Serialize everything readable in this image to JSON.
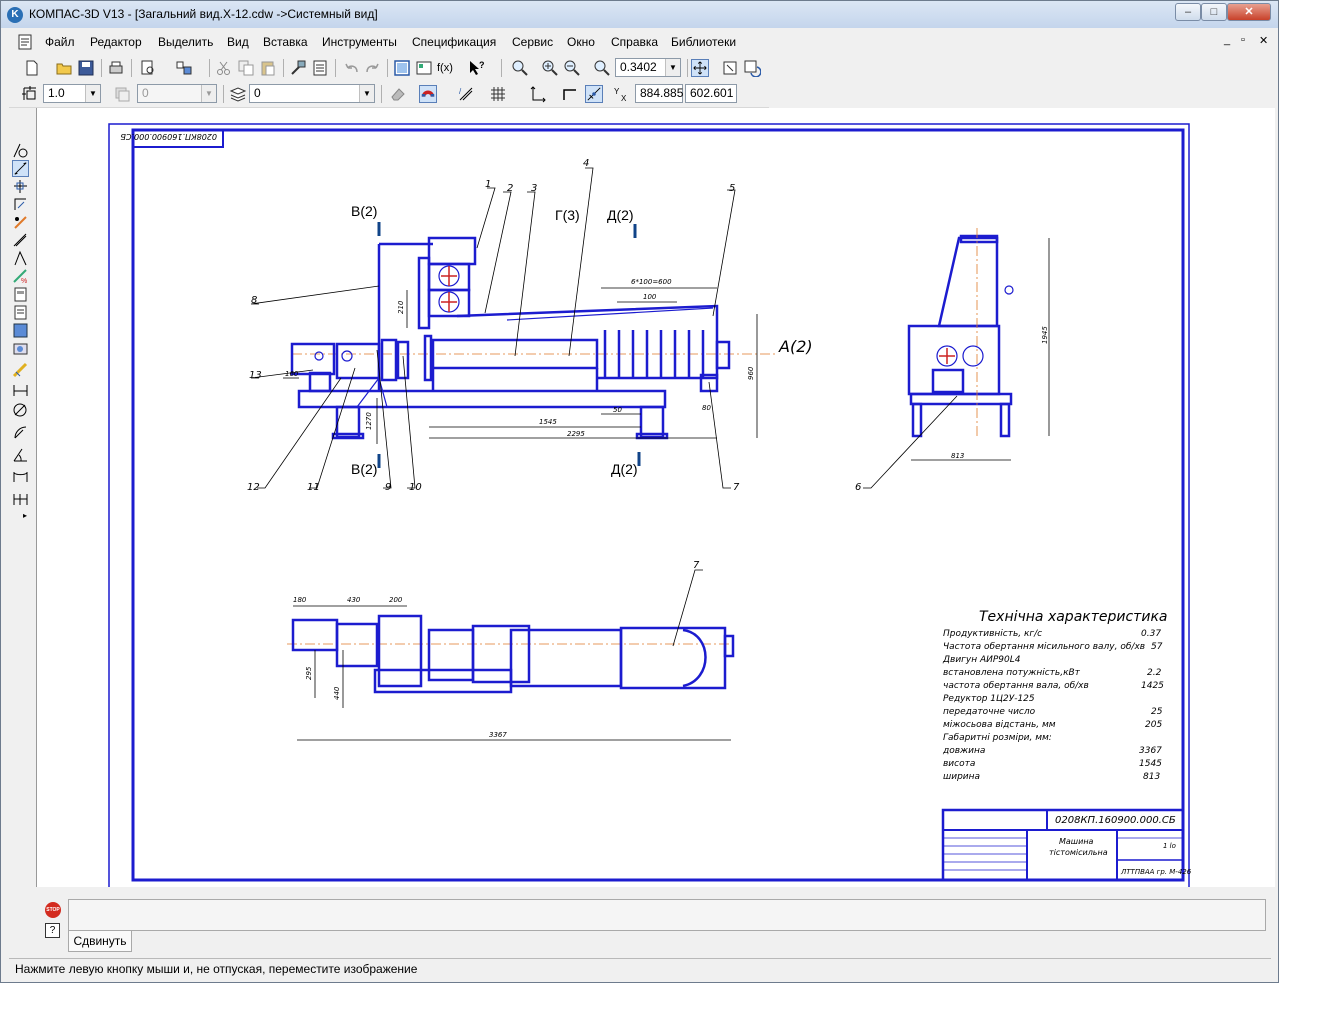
{
  "window": {
    "title": "КОМПАС-3D V13 - [Загальний вид.Х-12.cdw ->Системный вид]",
    "app_icon": "kompas-logo-icon",
    "controls": {
      "minimize": "–",
      "maximize": "□",
      "close": "✕"
    }
  },
  "menu": {
    "items": [
      "Файл",
      "Редактор",
      "Выделить",
      "Вид",
      "Вставка",
      "Инструменты",
      "Спецификация",
      "Сервис",
      "Окно",
      "Справка",
      "Библиотеки"
    ],
    "doc_controls": {
      "minimize": "_",
      "restore": "▫",
      "close": "✕"
    }
  },
  "toolbar1": {
    "zoom_value": "0.3402",
    "fx_label": "f(x)"
  },
  "toolbar2": {
    "line_scale": "1.0",
    "layer_disabled": "0",
    "style_value": "0",
    "coord_x": "884.885",
    "coord_y": "602.601"
  },
  "drawing": {
    "stamp_corner": "0208КП.160900.000.СБ",
    "view_labels": {
      "b_top": "В(2)",
      "b_bottom": "В(2)",
      "g": "Г(3)",
      "d_top": "Д(2)",
      "d_bottom": "Д(2)",
      "a": "А(2)"
    },
    "callouts": [
      "1",
      "2",
      "3",
      "4",
      "5",
      "6",
      "7",
      "8",
      "9",
      "10",
      "11",
      "12",
      "13",
      "7"
    ],
    "dimensions": {
      "d160": "160",
      "d210": "210",
      "d1270": "1270",
      "d1545": "1545",
      "d2295": "2295",
      "d50": "50",
      "d100": "100",
      "d6x100": "6*100=600",
      "d960": "960",
      "d1945": "1945",
      "d813": "813",
      "d180": "180",
      "d430": "430",
      "d200": "200",
      "d3367": "3367",
      "d295": "295",
      "d440": "440",
      "d80": "80"
    },
    "tech": {
      "title": "Технічна характеристика",
      "rows": [
        {
          "label": "Продуктивність, кг/с",
          "value": "0.37"
        },
        {
          "label": "Частота обертання місильного валу, об/хв",
          "value": "57"
        },
        {
          "label": "Двигун  АИР90L4",
          "value": ""
        },
        {
          "label": "  встановлена потужність,кВт",
          "value": "2.2"
        },
        {
          "label": "  частота обертання вала, об/хв",
          "value": "1425"
        },
        {
          "label": "Редуктор  1Ц2У-125",
          "value": ""
        },
        {
          "label": "  передаточне число",
          "value": "25"
        },
        {
          "label": "  міжосьова відстань, мм",
          "value": "205"
        },
        {
          "label": "Габаритні розміри, мм:",
          "value": ""
        },
        {
          "label": "    довжина",
          "value": "3367"
        },
        {
          "label": "    висота",
          "value": "1545"
        },
        {
          "label": "    ширина",
          "value": "813"
        }
      ]
    },
    "titleblock": {
      "code": "0208КП.160900.000.СБ",
      "name_line1": "Машина",
      "name_line2": "тістомісильна",
      "sheet": "1 lo",
      "org": "ЛТТПВАА гр. М-426"
    }
  },
  "command": {
    "stop_label": "STOP",
    "help_label": "?",
    "tab_label": "Сдвинуть"
  },
  "status": {
    "message": "Нажмите левую кнопку мыши и, не отпуская, переместите изображение"
  },
  "colors": {
    "drawing_line": "#1c1ccf",
    "axis_line": "#e07a2a",
    "title_gradient_top": "#dbe6f4"
  }
}
